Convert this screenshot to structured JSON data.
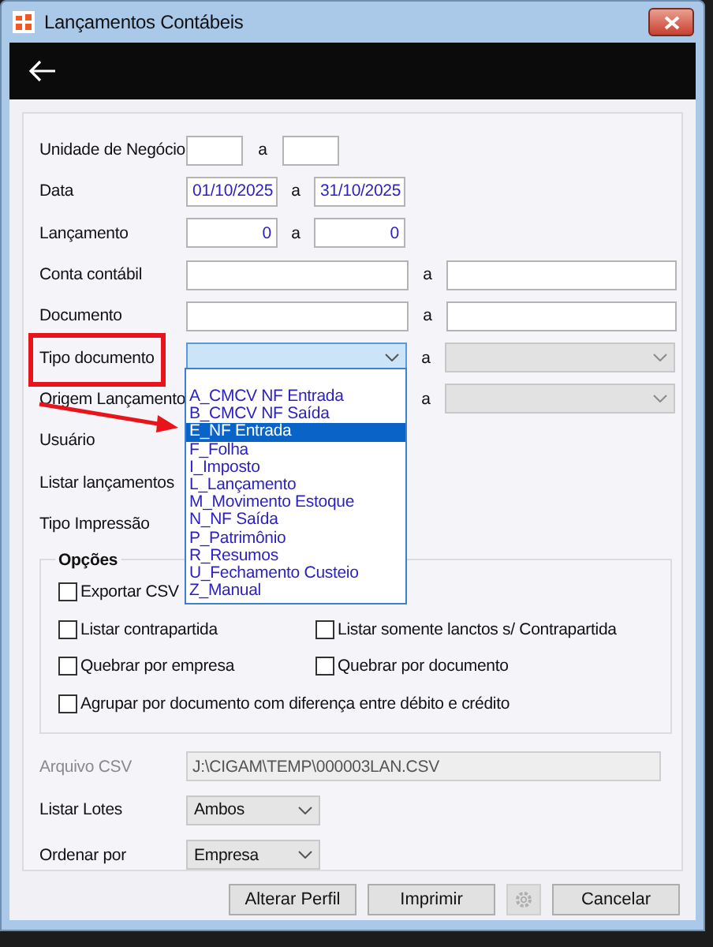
{
  "window": {
    "title": "Lançamentos Contábeis"
  },
  "rows": [
    {
      "kind": "short_range",
      "label": "Unidade de Negócio",
      "separator": "a"
    },
    {
      "kind": "date_range",
      "label": "Data",
      "from": "01/10/2025",
      "separator": "a",
      "to": "31/10/2025"
    },
    {
      "kind": "number_range",
      "label": "Lançamento",
      "from": "0",
      "separator": "a",
      "to": "0"
    },
    {
      "kind": "wide_range",
      "label": "Conta contábil",
      "separator": "a"
    },
    {
      "kind": "wide_range",
      "label": "Documento",
      "separator": "a"
    },
    {
      "kind": "combo_range",
      "label": "Tipo documento",
      "separator": "a",
      "focused": true,
      "to_disabled": true,
      "annotated": true
    },
    {
      "kind": "combo_to_only",
      "label": "Origem Lançamento",
      "separator": "a",
      "to_disabled": true
    },
    {
      "kind": "label",
      "label": "Usuário"
    },
    {
      "kind": "label",
      "label": "Listar lançamentos"
    },
    {
      "kind": "label",
      "label": "Tipo Impressão"
    }
  ],
  "dropdown_list": {
    "items": [
      {
        "label": "A_CMCV NF Entrada",
        "selected": false
      },
      {
        "label": "B_CMCV NF Saída",
        "selected": false
      },
      {
        "label": "E_NF Entrada",
        "selected": true
      },
      {
        "label": "F_Folha",
        "selected": false
      },
      {
        "label": "I_Imposto",
        "selected": false
      },
      {
        "label": "L_Lançamento",
        "selected": false
      },
      {
        "label": "M_Movimento Estoque",
        "selected": false
      },
      {
        "label": "N_NF Saída",
        "selected": false
      },
      {
        "label": "P_Patrimônio",
        "selected": false
      },
      {
        "label": "R_Resumos",
        "selected": false
      },
      {
        "label": "U_Fechamento Custeio",
        "selected": false
      },
      {
        "label": "Z_Manual",
        "selected": false
      }
    ]
  },
  "annotation_arrow": {
    "color": "#e8141c"
  },
  "options": {
    "title": "Opções",
    "checkbox_rows": [
      [
        {
          "label": "Exportar CSV",
          "checked": false
        }
      ],
      [
        {
          "label": "Listar contrapartida",
          "checked": false
        },
        {
          "label": "Listar somente lanctos s/ Contrapartida",
          "checked": false
        }
      ],
      [
        {
          "label": "Quebrar por empresa",
          "checked": false
        },
        {
          "label": "Quebrar por documento",
          "checked": false
        }
      ],
      [
        {
          "label": "Agrupar por documento com diferença entre débito e crédito",
          "checked": false
        }
      ]
    ]
  },
  "csv_file": {
    "label": "Arquivo CSV",
    "value": "J:\\CIGAM\\TEMP\\000003LAN.CSV",
    "disabled": true
  },
  "selects": [
    {
      "label": "Listar Lotes",
      "value": "Ambos"
    },
    {
      "label": "Ordenar por",
      "value": "Empresa"
    }
  ],
  "buttons": [
    {
      "kind": "text",
      "label": "Alterar Perfil"
    },
    {
      "kind": "text",
      "label": "Imprimir"
    },
    {
      "kind": "gear",
      "disabled": true
    },
    {
      "kind": "text",
      "label": "Cancelar"
    }
  ]
}
